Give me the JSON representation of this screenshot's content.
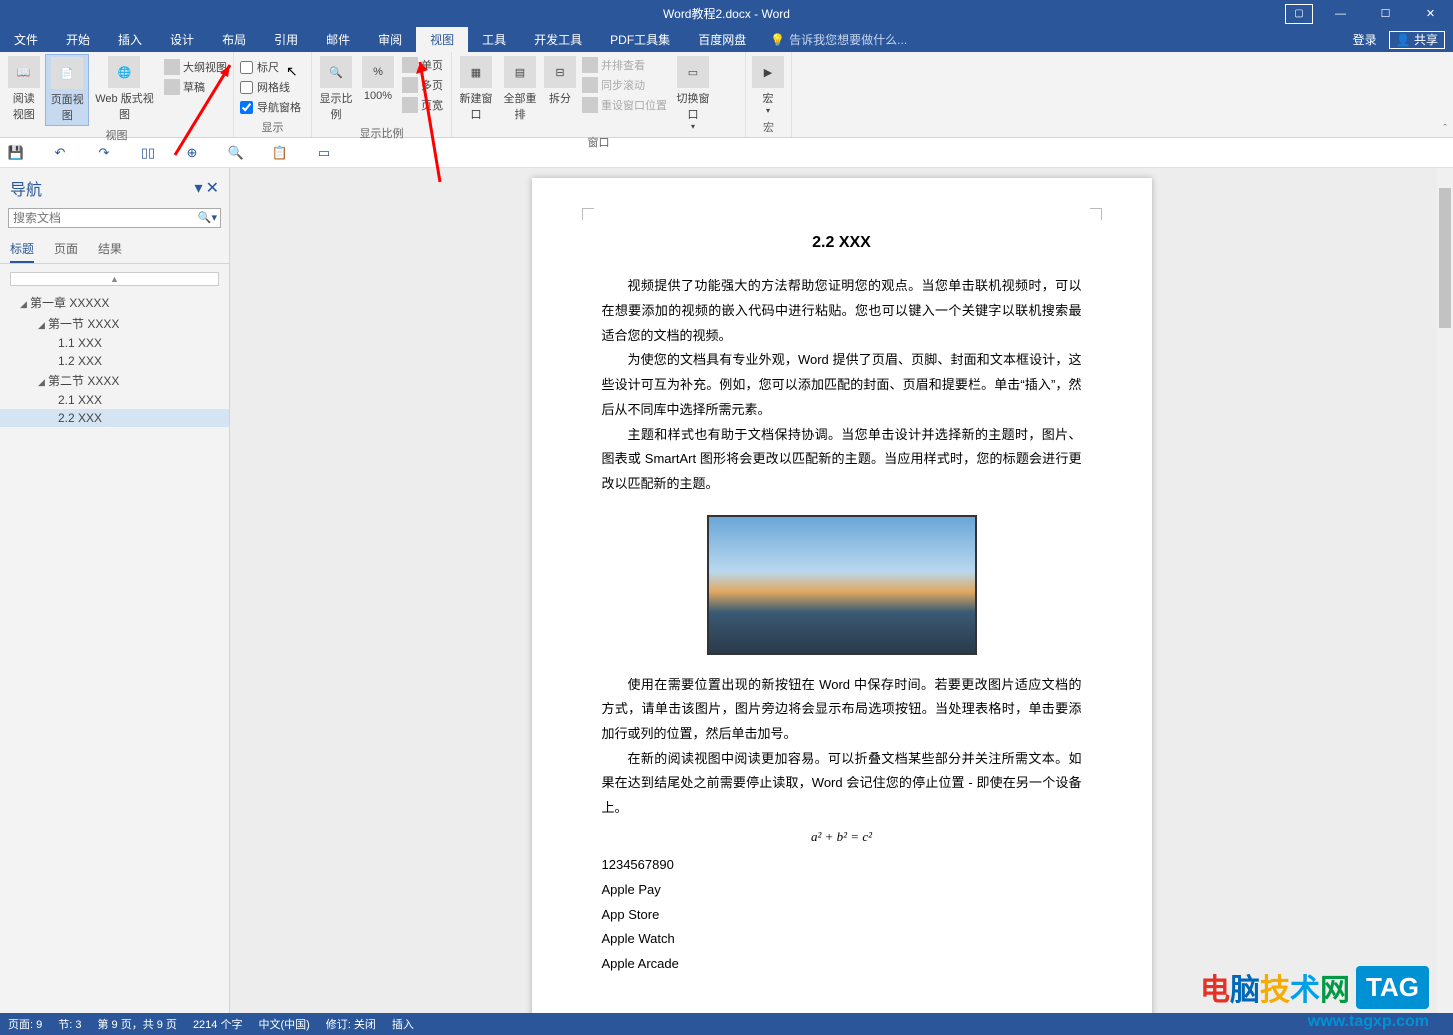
{
  "title": "Word教程2.docx - Word",
  "title_right": {
    "login": "登录",
    "share": "共享"
  },
  "tabs": [
    "文件",
    "开始",
    "插入",
    "设计",
    "布局",
    "引用",
    "邮件",
    "审阅",
    "视图",
    "工具",
    "开发工具",
    "PDF工具集",
    "百度网盘"
  ],
  "active_tab": "视图",
  "tellme": "告诉我您想要做什么...",
  "ribbon": {
    "grp_view": {
      "label": "视图",
      "read": "阅读\n视图",
      "print": "页面视图",
      "web": "Web 版式视图",
      "outline": "大纲视图",
      "draft": "草稿"
    },
    "grp_show": {
      "label": "显示",
      "ruler": "标尺",
      "grid": "网格线",
      "navpane": "导航窗格"
    },
    "grp_zoom": {
      "label": "显示比例",
      "zoom": "显示比例",
      "p100": "100%",
      "single": "单页",
      "multi": "多页",
      "width": "页宽"
    },
    "grp_window": {
      "label": "窗口",
      "newwin": "新建窗口",
      "arrange": "全部重排",
      "split": "拆分",
      "side": "并排查看",
      "sync": "同步滚动",
      "reset": "重设窗口位置",
      "switch": "切换窗口"
    },
    "grp_macro": {
      "label": "宏",
      "macro": "宏"
    }
  },
  "nav": {
    "title": "导航",
    "search_placeholder": "搜索文档",
    "tabs": [
      "标题",
      "页面",
      "结果"
    ],
    "tree": [
      {
        "level": 1,
        "exp": true,
        "text": "第一章 XXXXX"
      },
      {
        "level": 2,
        "exp": true,
        "text": "第一节 XXXX"
      },
      {
        "level": 3,
        "text": "1.1 XXX"
      },
      {
        "level": 3,
        "text": "1.2 XXX"
      },
      {
        "level": 2,
        "exp": true,
        "text": "第二节 XXXX"
      },
      {
        "level": 3,
        "text": "2.1 XXX"
      },
      {
        "level": 3,
        "text": "2.2 XXX",
        "selected": true
      }
    ]
  },
  "document": {
    "heading": "2.2 XXX",
    "p1": "视频提供了功能强大的方法帮助您证明您的观点。当您单击联机视频时，可以在想要添加的视频的嵌入代码中进行粘贴。您也可以键入一个关键字以联机搜索最适合您的文档的视频。",
    "p2": "为使您的文档具有专业外观，Word 提供了页眉、页脚、封面和文本框设计，这些设计可互为补充。例如，您可以添加匹配的封面、页眉和提要栏。单击“插入”，然后从不同库中选择所需元素。",
    "p3": "主题和样式也有助于文档保持协调。当您单击设计并选择新的主题时，图片、图表或 SmartArt 图形将会更改以匹配新的主题。当应用样式时，您的标题会进行更改以匹配新的主题。",
    "p4": "使用在需要位置出现的新按钮在 Word 中保存时间。若要更改图片适应文档的方式，请单击该图片，图片旁边将会显示布局选项按钮。当处理表格时，单击要添加行或列的位置，然后单击加号。",
    "p5": "在新的阅读视图中阅读更加容易。可以折叠文档某些部分并关注所需文本。如果在达到结尾处之前需要停止读取，Word 会记住您的停止位置 - 即使在另一个设备上。",
    "formula": "a² + b² = c²",
    "lines": [
      "1234567890",
      "Apple Pay",
      "App Store",
      "Apple Watch",
      "Apple Arcade"
    ]
  },
  "status": {
    "page": "页面: 9",
    "section": "节: 3",
    "pageof": "第 9 页，共 9 页",
    "words": "2214 个字",
    "lang": "中文(中国)",
    "track": "修订: 关闭",
    "insert": "插入"
  },
  "watermark": {
    "cn": "电脑技术网",
    "tag": "TAG",
    "url": "www.tagxp.com"
  }
}
